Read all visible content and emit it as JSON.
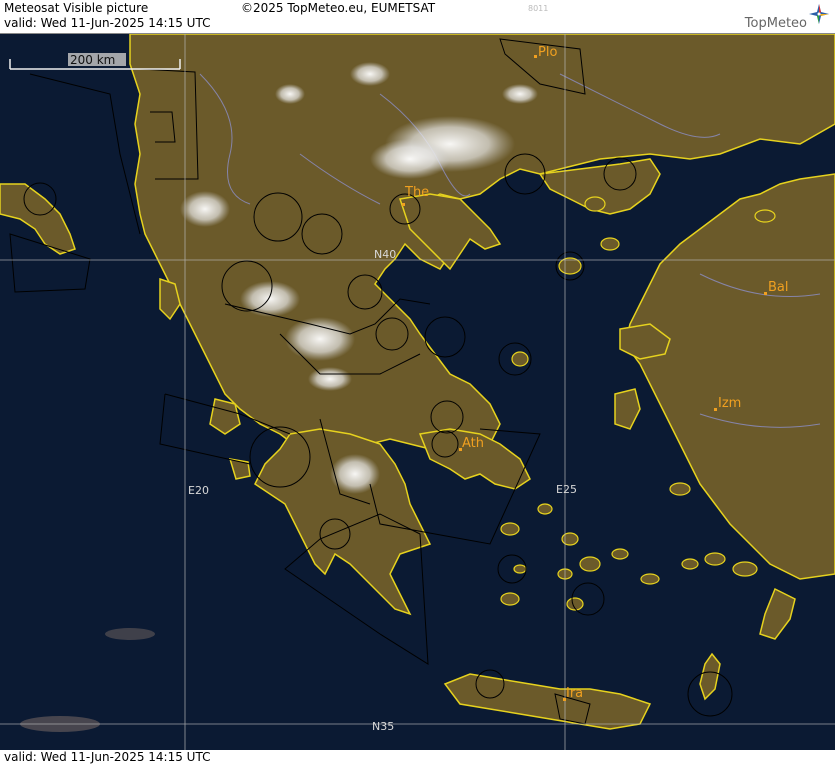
{
  "header": {
    "title": "Meteosat Visible picture",
    "valid": "valid:  Wed  11-Jun-2025  14:15 UTC",
    "copyright": "©2025 TopMeteo.eu, EUMETSAT",
    "code": "8011",
    "logo": "TopMeteo"
  },
  "footer": {
    "valid": "valid:  Wed  11-Jun-2025  14:15 UTC"
  },
  "map": {
    "scale_label": "200 km",
    "grid_labels": {
      "lat40": "N40",
      "lat35": "N35",
      "lon20": "E20",
      "lon25": "E25"
    },
    "cities": [
      {
        "label": "Plo"
      },
      {
        "label": "The"
      },
      {
        "label": "Bal"
      },
      {
        "label": "Izm"
      },
      {
        "label": "Ath"
      },
      {
        "label": "Ira"
      }
    ],
    "colors": {
      "sea": "#0b1a33",
      "land": "#6b5a2a",
      "coast": "#e6d21e",
      "city": "#f0a020",
      "grid": "#b8b8b8"
    }
  }
}
